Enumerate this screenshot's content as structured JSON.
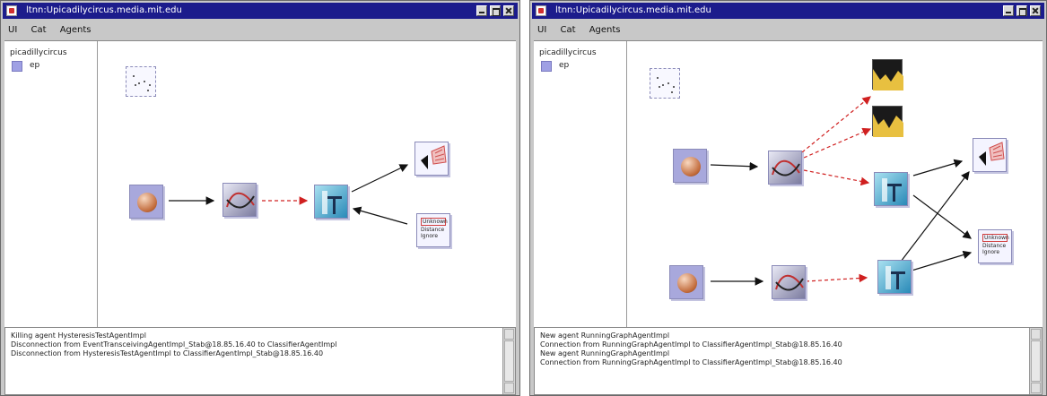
{
  "windows": [
    {
      "title": "ltnn:Upicadilycircus.media.mit.edu",
      "menu": [
        "UI",
        "Cat",
        "Agents"
      ],
      "sidebar": {
        "host": "picadillycircus",
        "swatch_label": "ep"
      },
      "log": [
        "Killing agent HysteresisTestAgentImpl",
        "Disconnection from EventTransceivingAgentImpl_Stab@18.85.16.40 to ClassifierAgentImpl",
        "Disconnection from HysteresisTestAgentImpl to ClassifierAgentImpl_Stab@18.85.16.40"
      ],
      "text_node": {
        "line1": "Unknown",
        "line2": "Distance",
        "line3": "Ignore"
      }
    },
    {
      "title": "ltnn:Upicadilycircus.media.mit.edu",
      "menu": [
        "UI",
        "Cat",
        "Agents"
      ],
      "sidebar": {
        "host": "picadillycircus",
        "swatch_label": "ep"
      },
      "log": [
        "New agent RunningGraphAgentImpl",
        "Connection from RunningGraphAgentImpl to ClassifierAgentImpl_Stab@18.85.16.40",
        "New agent RunningGraphAgentImpl",
        "Connection from RunningGraphAgentImpl to ClassifierAgentImpl_Stab@18.85.16.40"
      ],
      "text_node": {
        "line1": "Unknown",
        "line2": "Distance",
        "line3": "Ignore"
      }
    }
  ],
  "colors": {
    "titlebar": "#1c1c8c",
    "link_black": "#111111",
    "link_red": "#d02020",
    "swatch": "#9fa0e4"
  },
  "icons": [
    "app-icon",
    "minimize-icon",
    "maximize-icon",
    "close-icon",
    "sphere-sensor-icon",
    "graph-agent-icon",
    "classifier-icon",
    "speaker-icon",
    "text-output-icon",
    "scatter-plot-icon",
    "area-chart-icon"
  ]
}
